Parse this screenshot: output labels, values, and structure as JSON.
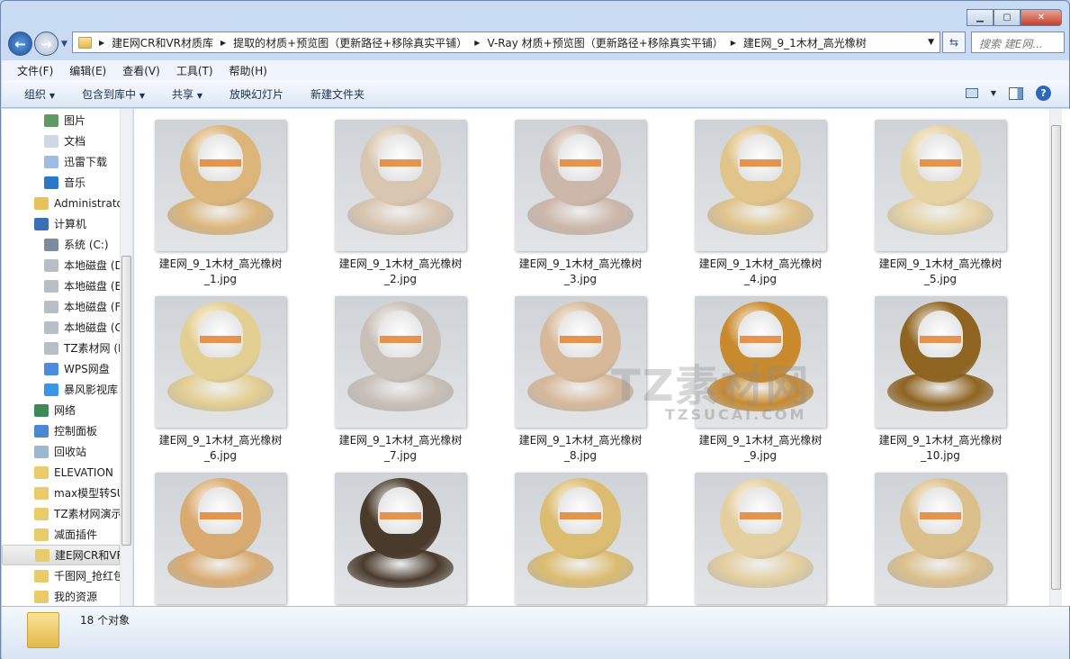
{
  "address": {
    "segments": [
      "建E网CR和VR材质库",
      "提取的材质+预览图（更新路径+移除真实平铺）",
      "V-Ray 材质+预览图（更新路径+移除真实平铺）",
      "建E网_9_1木材_高光橡树"
    ]
  },
  "search": {
    "placeholder": "搜索 建E网..."
  },
  "menu": [
    "文件(F)",
    "编辑(E)",
    "查看(V)",
    "工具(T)",
    "帮助(H)"
  ],
  "toolbar": {
    "organize": "组织",
    "include": "包含到库中",
    "share": "共享",
    "slideshow": "放映幻灯片",
    "new_folder": "新建文件夹"
  },
  "sidebar": [
    {
      "label": "图片",
      "indent": 2,
      "icon": "pictures-icon",
      "color": "#5f9a63"
    },
    {
      "label": "文档",
      "indent": 2,
      "icon": "documents-icon",
      "color": "#cfd8e4"
    },
    {
      "label": "迅雷下载",
      "indent": 2,
      "icon": "download-icon",
      "color": "#9fbde3"
    },
    {
      "label": "音乐",
      "indent": 2,
      "icon": "music-icon",
      "color": "#2b77c8"
    },
    {
      "label": "Administrator",
      "indent": 1,
      "icon": "user-folder-icon",
      "color": "#e6c35a"
    },
    {
      "label": "计算机",
      "indent": 1,
      "icon": "computer-icon",
      "color": "#3b6fb5"
    },
    {
      "label": "系统 (C:)",
      "indent": 2,
      "icon": "system-drive-icon",
      "color": "#7c8c9c"
    },
    {
      "label": "本地磁盘 (D:)",
      "indent": 2,
      "icon": "drive-icon",
      "color": "#b8bec6"
    },
    {
      "label": "本地磁盘 (E:)",
      "indent": 2,
      "icon": "drive-icon",
      "color": "#b8bec6"
    },
    {
      "label": "本地磁盘 (F:)",
      "indent": 2,
      "icon": "drive-icon",
      "color": "#b8bec6"
    },
    {
      "label": "本地磁盘 (G:)",
      "indent": 2,
      "icon": "drive-icon",
      "color": "#b8bec6"
    },
    {
      "label": "TZ素材网 (H:)",
      "indent": 2,
      "icon": "drive-icon",
      "color": "#b8bec6"
    },
    {
      "label": "WPS网盘",
      "indent": 2,
      "icon": "cloud-icon",
      "color": "#4a8de0"
    },
    {
      "label": "暴风影视库",
      "indent": 2,
      "icon": "video-library-icon",
      "color": "#3a95e6"
    },
    {
      "label": "网络",
      "indent": 1,
      "icon": "network-icon",
      "color": "#3a8a5a"
    },
    {
      "label": "控制面板",
      "indent": 1,
      "icon": "control-panel-icon",
      "color": "#4a88d0"
    },
    {
      "label": "回收站",
      "indent": 1,
      "icon": "recycle-bin-icon",
      "color": "#9fb6d0"
    },
    {
      "label": "ELEVATION",
      "indent": 1,
      "icon": "folder-icon",
      "color": "#eacb6a"
    },
    {
      "label": "max模型转SU",
      "indent": 1,
      "icon": "folder-icon",
      "color": "#eacb6a"
    },
    {
      "label": "TZ素材网演示",
      "indent": 1,
      "icon": "folder-icon",
      "color": "#eacb6a"
    },
    {
      "label": "减面插件",
      "indent": 1,
      "icon": "folder-icon",
      "color": "#eacb6a"
    },
    {
      "label": "建E网CR和VR材质库",
      "indent": 1,
      "icon": "folder-icon",
      "color": "#eacb6a",
      "selected": true
    },
    {
      "label": "千图网_抢红包",
      "indent": 1,
      "icon": "folder-icon",
      "color": "#eacb6a"
    },
    {
      "label": "我的资源",
      "indent": 1,
      "icon": "folder-icon",
      "color": "#eacb6a"
    }
  ],
  "files": [
    {
      "name": "建E网_9_1木材_高光橡树",
      "ext": "_1.jpg",
      "color": "#dcb57a"
    },
    {
      "name": "建E网_9_1木材_高光橡树",
      "ext": "_2.jpg",
      "color": "#d9c6b0"
    },
    {
      "name": "建E网_9_1木材_高光橡树",
      "ext": "_3.jpg",
      "color": "#cdb7aa"
    },
    {
      "name": "建E网_9_1木材_高光橡树",
      "ext": "_4.jpg",
      "color": "#e0c48a"
    },
    {
      "name": "建E网_9_1木材_高光橡树",
      "ext": "_5.jpg",
      "color": "#e6d3a4"
    },
    {
      "name": "建E网_9_1木材_高光橡树",
      "ext": "_6.jpg",
      "color": "#e4cf92"
    },
    {
      "name": "建E网_9_1木材_高光橡树",
      "ext": "_7.jpg",
      "color": "#c9c0b8"
    },
    {
      "name": "建E网_9_1木材_高光橡树",
      "ext": "_8.jpg",
      "color": "#d7b99a"
    },
    {
      "name": "建E网_9_1木材_高光橡树",
      "ext": "_9.jpg",
      "color": "#c98a2e"
    },
    {
      "name": "建E网_9_1木材_高光橡树",
      "ext": "_10.jpg",
      "color": "#8f6420"
    },
    {
      "name": "",
      "ext": "",
      "color": "#d9ab70"
    },
    {
      "name": "",
      "ext": "",
      "color": "#4a3a2c"
    },
    {
      "name": "",
      "ext": "",
      "color": "#dcbc70"
    },
    {
      "name": "",
      "ext": "",
      "color": "#e4cfa0"
    },
    {
      "name": "",
      "ext": "",
      "color": "#dcc08c"
    }
  ],
  "watermark": {
    "title": "TZ素材网",
    "url": "TZSUCAI.COM"
  },
  "status": {
    "count": "18 个对象"
  }
}
